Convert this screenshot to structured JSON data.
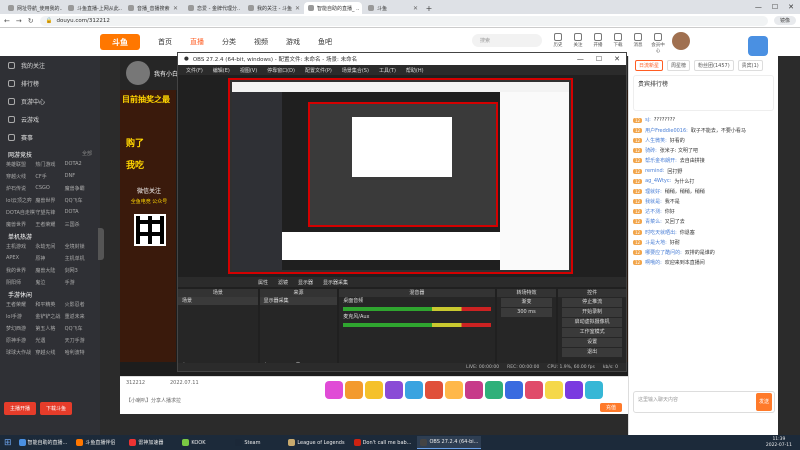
{
  "browser": {
    "tabs": [
      {
        "label": "网址导航_使用我的..",
        "active": false
      },
      {
        "label": "斗鱼直播-上网从此..",
        "active": false
      },
      {
        "label": "音播_音播搜索",
        "active": false
      },
      {
        "label": "恋爱 - 金牌代理分..",
        "active": false
      },
      {
        "label": "我的关注 - 斗鱼",
        "active": false
      },
      {
        "label": "智能自助的直播_ ..",
        "active": true
      },
      {
        "label": "斗鱼",
        "active": false
      }
    ],
    "url": "douyu.com/312212",
    "update_label": "镜像"
  },
  "site": {
    "logo": "斗鱼",
    "nav": [
      "首页",
      "直播",
      "分类",
      "视频",
      "游戏",
      "鱼吧"
    ],
    "nav_active": 1,
    "search_placeholder": "搜索",
    "header_icons": [
      "历史",
      "关注",
      "开播",
      "下载",
      "消息",
      "会员中心"
    ]
  },
  "sidebar": {
    "top_items": [
      "我的关注",
      "排行榜",
      "页游中心",
      "云游戏",
      "赛事"
    ],
    "section1_title": "网游竞技",
    "section1_more": "全部",
    "section1_grid": [
      "英雄联盟",
      "热门游戏",
      "DOTA2",
      "穿越火线",
      "CF手",
      "DNF",
      "炉石传说",
      "CSGO",
      "魔兽争霸",
      "lol云顶之弈",
      "魔兽世界",
      "QQ飞车",
      "DOTA自走棋",
      "守望先锋",
      "DOTA",
      "魔兽世界",
      "王者荣耀",
      "三国杀"
    ],
    "section2_title": "单机热游",
    "section2_grid": [
      "主机游戏",
      "永劫无间",
      "全境封锁",
      "APEX",
      "原神",
      "主机单机",
      "我的世界",
      "魔兽大陆",
      "剑网3",
      "阴阳师",
      "鬼泣",
      "手游"
    ],
    "section3_title": "手游休闲",
    "section3_grid": [
      "王者荣耀",
      "和平精英",
      "火影忍者",
      "lol手游",
      "金铲铲之战",
      "重返未来",
      "梦幻西游",
      "第五人格",
      "QQ飞车",
      "原神手游",
      "光遇",
      "天刀手游",
      "球球大作战",
      "穿越火线",
      "哈利波特"
    ],
    "btn_anchor": "主播开播",
    "btn_download": "下载斗鱼"
  },
  "player": {
    "anchor_name": "我有小白兽",
    "room_id": "312212",
    "date": "2022.07.11",
    "banner_left_line1": "目前抽奖之最",
    "banner_right_line1": "神户",
    "hot_text1": "购了",
    "hot_text2": "我吃",
    "follow_text": "微信关注",
    "follow_sub": "全鱼电竞 公众号",
    "notice": "【小喇叭】分享人播求拉"
  },
  "obs": {
    "title": "OBS 27.2.4 (64-bit, windows) - 配置文件: 未命名 - 场景: 未命名",
    "menu": [
      "文件(F)",
      "编辑(E)",
      "视图(V)",
      "停靠窗口(D)",
      "配置文件(P)",
      "场景集合(S)",
      "工具(T)",
      "帮助(H)"
    ],
    "canvas_bar": [
      "属性",
      "滤镜",
      "显示器",
      "显示器采集"
    ],
    "docks": {
      "scenes_title": "场景",
      "scenes": [
        "场景"
      ],
      "sources_title": "来源",
      "sources": [
        "显示器采集"
      ],
      "mixer_title": "混音器",
      "mixer_tracks": [
        "桌面音频",
        "麦克风/Aux"
      ],
      "mixer_db": [
        "0.0 dB",
        "0.0 dB"
      ],
      "transitions_title": "转场特效",
      "transition_type": "渐变",
      "transition_duration": "300 ms",
      "controls_title": "控件",
      "controls": [
        "停止推流",
        "开始录制",
        "启动虚拟摄像机",
        "工作室模式",
        "设置",
        "退出"
      ]
    },
    "status": [
      "LIVE: 00:00:00",
      "REC: 00:00:00",
      "CPU: 1.9%, 60.00 fps",
      "kb/s: 0"
    ]
  },
  "giftbar": {
    "count_label": "已赠送",
    "recharge": "充值"
  },
  "right_panel": {
    "tabs": [
      "日流新星",
      "周星榜",
      "粉丝团(1457)",
      "贵宾(1)"
    ],
    "active_tab": 0,
    "rank_title": "贵宾排行榜",
    "chat": [
      {
        "lv": "12",
        "user": "sj:",
        "msg": "????????"
      },
      {
        "lv": "12",
        "user": "用户Freddie0016:",
        "msg": "取子不能去，不要小看马"
      },
      {
        "lv": "12",
        "user": "人生微笑:",
        "msg": "好看的"
      },
      {
        "lv": "12",
        "user": "骑砖:",
        "msg": "张米子: 文明了吧"
      },
      {
        "lv": "12",
        "user": "帮乐金布朗开:",
        "msg": "去自由拼接"
      },
      {
        "lv": "12",
        "user": "remind:",
        "msg": "回打野"
      },
      {
        "lv": "12",
        "user": "ag_4Wtyc:",
        "msg": "为什么打"
      },
      {
        "lv": "12",
        "user": "理就好:",
        "msg": "稍稍，稍稍，稍稍"
      },
      {
        "lv": "12",
        "user": "我就是:",
        "msg": "我不是"
      },
      {
        "lv": "12",
        "user": "达不测:",
        "msg": "你好"
      },
      {
        "lv": "12",
        "user": "青菜么:",
        "msg": "又回了去"
      },
      {
        "lv": "12",
        "user": "时吃天就晒出:",
        "msg": "你退塞"
      },
      {
        "lv": "12",
        "user": "斗是大地:",
        "msg": "好耐"
      },
      {
        "lv": "12",
        "user": "哪要应了酷问的:",
        "msg": "双排的是谁的"
      },
      {
        "lv": "12",
        "user": "啊哦的:",
        "msg": "欢迎来到本直播间"
      }
    ],
    "chat_placeholder": "这里输入聊天内容",
    "send_label": "发送"
  },
  "taskbar": {
    "items": [
      {
        "label": "智能自助的直播...",
        "color": "#4a90e2",
        "on": false
      },
      {
        "label": "斗鱼直播伴侣",
        "color": "#ff7700",
        "on": false
      },
      {
        "label": "雷神加速器",
        "color": "#e33",
        "on": false
      },
      {
        "label": "KOOK",
        "color": "#7ac943",
        "on": false
      },
      {
        "label": "Steam",
        "color": "#1b2838",
        "on": false
      },
      {
        "label": "League of Legends",
        "color": "#c8aa6e",
        "on": false
      },
      {
        "label": "Don't call me bab...",
        "color": "#c21",
        "on": false
      },
      {
        "label": "OBS 27.2.4 (64-bi...",
        "color": "#444",
        "on": true
      }
    ],
    "time": "11:39",
    "date": "2022-07-11"
  },
  "colors": {
    "accent": "#ff5d23",
    "sidebar_bg": "#2f3035",
    "obs_red": "#d40000"
  }
}
